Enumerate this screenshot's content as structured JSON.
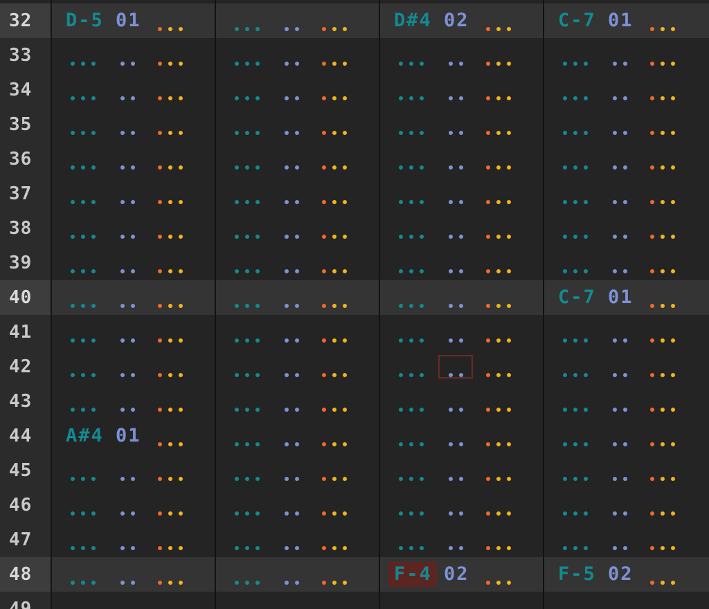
{
  "tracker": {
    "empty_note": "...",
    "empty_inst": "..",
    "empty_vol": "...",
    "highlight_every": 8,
    "rows": [
      {
        "num": "32",
        "cells": [
          {
            "note": "D-5",
            "inst": "01"
          },
          {},
          {
            "note": "D#4",
            "inst": "02"
          },
          {
            "note": "C-7",
            "inst": "01"
          }
        ]
      },
      {
        "num": "33",
        "cells": [
          {},
          {},
          {},
          {}
        ]
      },
      {
        "num": "34",
        "cells": [
          {},
          {},
          {},
          {}
        ]
      },
      {
        "num": "35",
        "cells": [
          {},
          {},
          {},
          {}
        ]
      },
      {
        "num": "36",
        "cells": [
          {},
          {},
          {},
          {}
        ]
      },
      {
        "num": "37",
        "cells": [
          {},
          {},
          {},
          {}
        ]
      },
      {
        "num": "38",
        "cells": [
          {},
          {},
          {},
          {}
        ]
      },
      {
        "num": "39",
        "cells": [
          {},
          {},
          {},
          {}
        ]
      },
      {
        "num": "40",
        "cells": [
          {},
          {},
          {},
          {
            "note": "C-7",
            "inst": "01"
          }
        ]
      },
      {
        "num": "41",
        "cells": [
          {},
          {},
          {},
          {}
        ]
      },
      {
        "num": "42",
        "cells": [
          {},
          {},
          {
            "cursor": "inst"
          },
          {}
        ]
      },
      {
        "num": "43",
        "cells": [
          {},
          {},
          {},
          {}
        ]
      },
      {
        "num": "44",
        "cells": [
          {
            "note": "A#4",
            "inst": "01"
          },
          {},
          {},
          {}
        ]
      },
      {
        "num": "45",
        "cells": [
          {},
          {},
          {},
          {}
        ]
      },
      {
        "num": "46",
        "cells": [
          {},
          {},
          {},
          {}
        ]
      },
      {
        "num": "47",
        "cells": [
          {},
          {},
          {},
          {}
        ]
      },
      {
        "num": "48",
        "cells": [
          {},
          {},
          {
            "note": "F-4",
            "inst": "02",
            "note_highlight": true
          },
          {
            "note": "F-5",
            "inst": "02"
          }
        ]
      },
      {
        "num": "49",
        "cells": [
          {},
          {},
          {},
          {}
        ]
      }
    ]
  }
}
